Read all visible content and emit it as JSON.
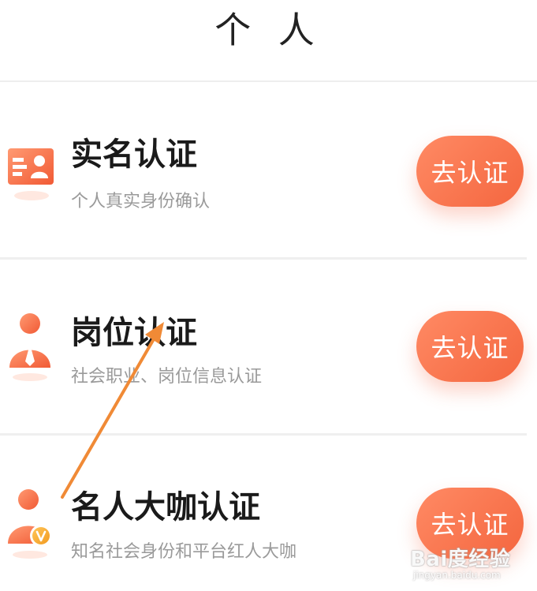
{
  "header": {
    "title": "个 人"
  },
  "items": [
    {
      "title": "实名认证",
      "subtitle": "个人真实身份确认",
      "button_label": "去认证",
      "icon": "id-card-icon"
    },
    {
      "title": "岗位认证",
      "subtitle": "社会职业、岗位信息认证",
      "button_label": "去认证",
      "icon": "employee-icon"
    },
    {
      "title": "名人大咖认证",
      "subtitle": "知名社会身份和平台红人大咖",
      "button_label": "去认证",
      "icon": "vip-person-icon"
    }
  ],
  "watermark": {
    "main": "Bai度经验",
    "sub": "jingyan.baidu.com"
  },
  "colors": {
    "accent": "#f4663f",
    "accent_light": "#ff8a64",
    "arrow": "#f08a36",
    "title": "#1a1a1a",
    "subtitle": "#9a9a9a"
  }
}
